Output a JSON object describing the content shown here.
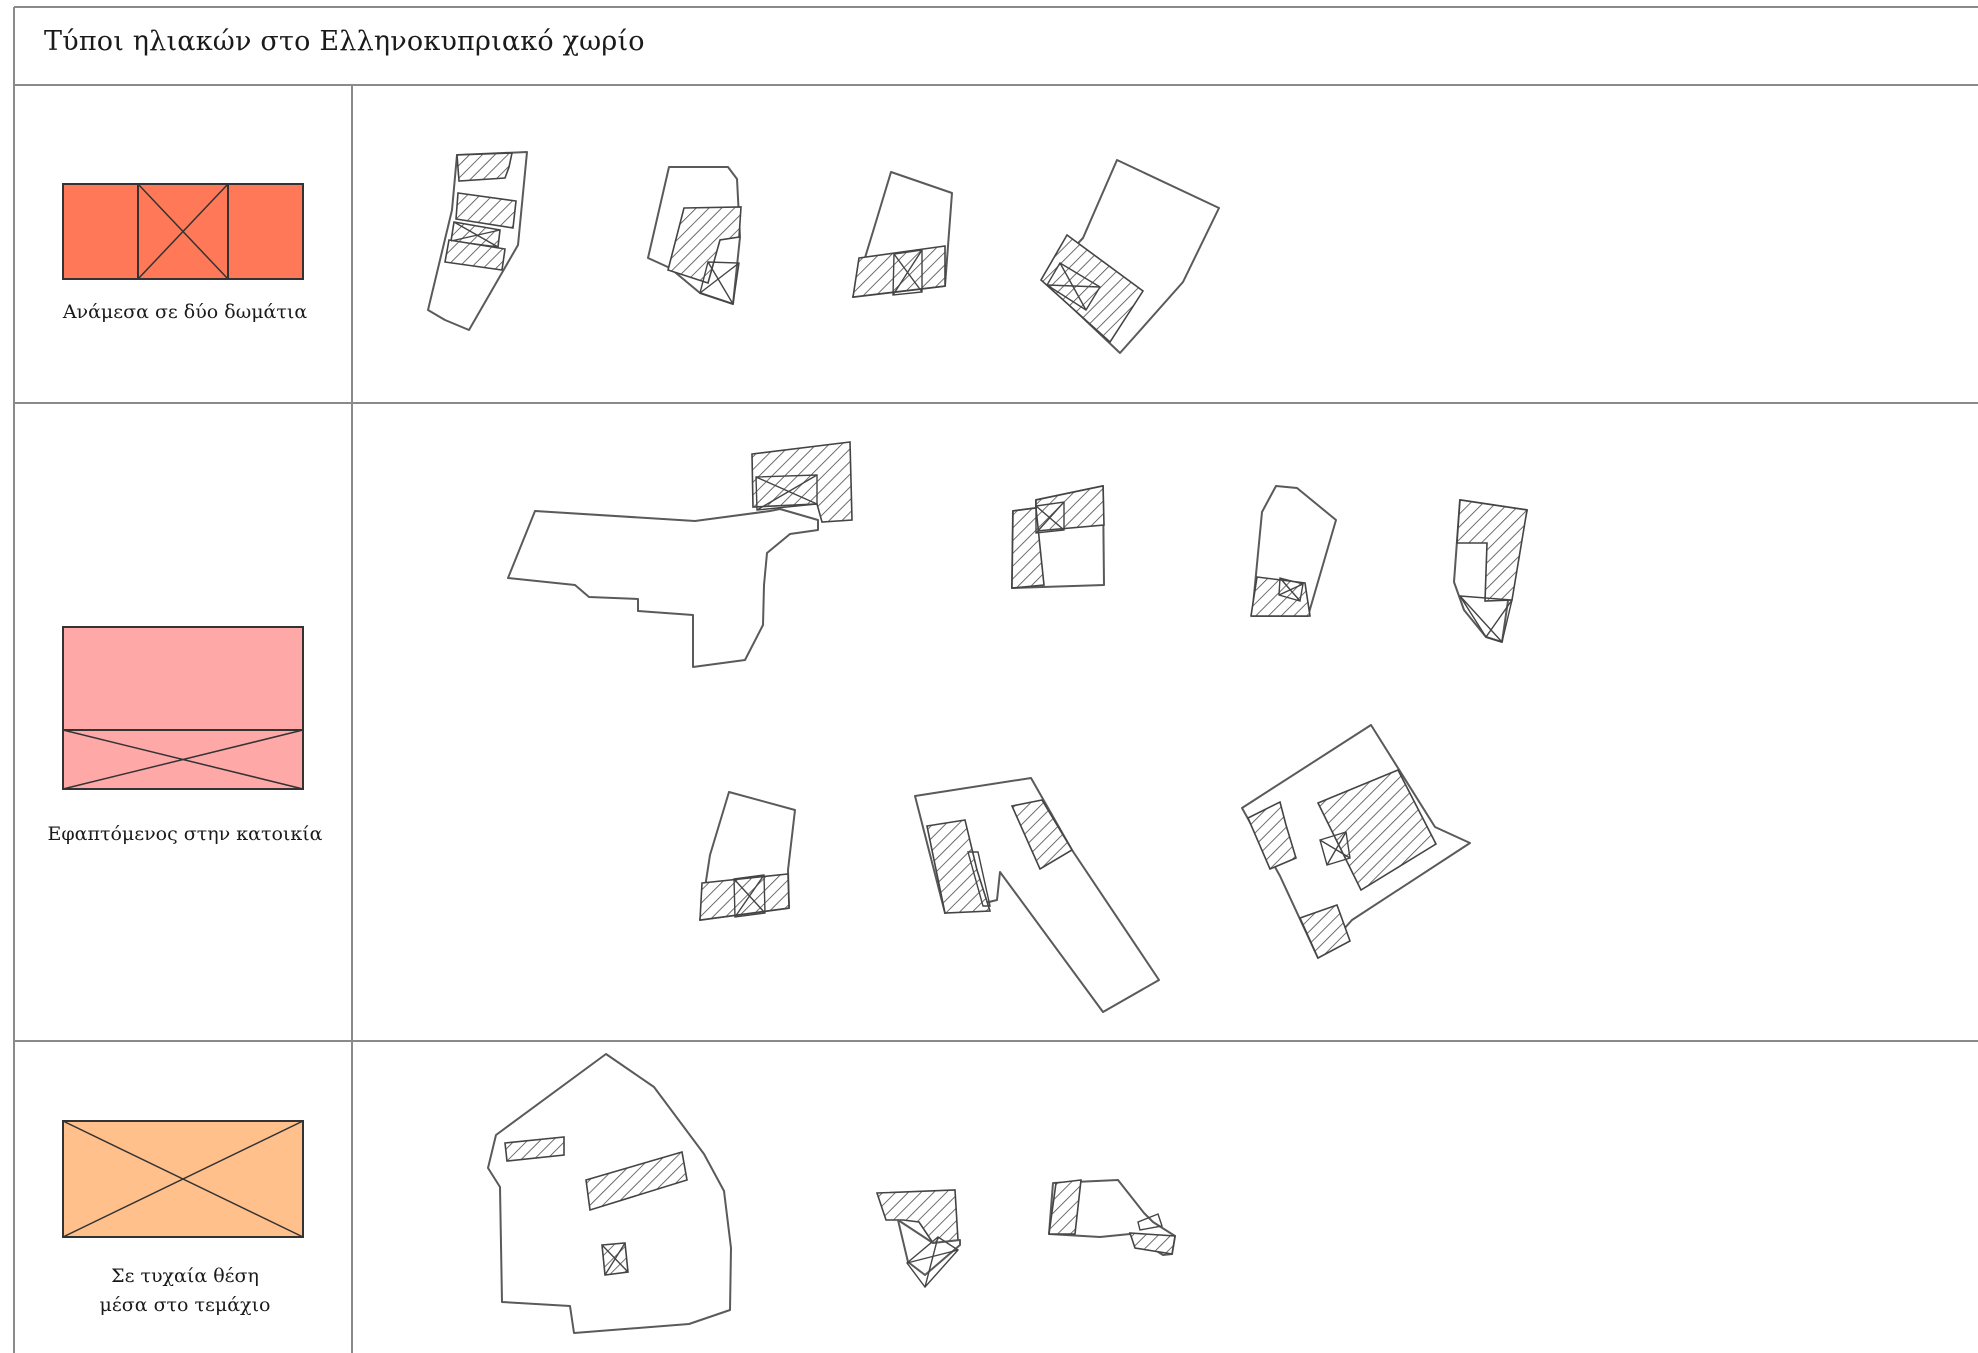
{
  "title": "Τύποι ηλιακών στο Ελληνοκυπριακό χωρίο",
  "rows": [
    {
      "caption": "Ανάμεσα σε δύο δωμάτια",
      "legend_color": "#FF7858"
    },
    {
      "caption": "Εφαπτόμενος στην κατοικία",
      "legend_color": "#FFA8A8"
    },
    {
      "caption_line1": "Σε τυχαία θέση",
      "caption_line2": "μέσα στο τεμάχιο",
      "legend_color": "#FFC08C"
    }
  ],
  "colors": {
    "grid_line": "#8a8a8a",
    "outline": "#5a5a5a",
    "hatch": "#444444"
  }
}
